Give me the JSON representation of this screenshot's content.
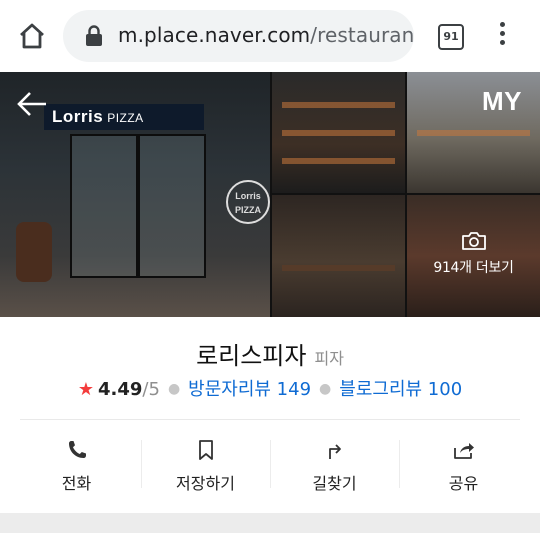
{
  "browser": {
    "url_domain": "m.place.naver.com",
    "url_path": "/restaurant/",
    "tab_count": "91"
  },
  "gallery": {
    "corner_label": "MY",
    "more_photos_label": "914개 더보기",
    "storefront_sign": "Lorris",
    "storefront_sign_sub": "PIZZA",
    "round_logo_line1": "Lorris",
    "round_logo_line2": "PIZZA"
  },
  "place": {
    "name": "로리스피자",
    "category": "피자",
    "rating": "4.49",
    "rating_max": "/5",
    "visitor_reviews": "방문자리뷰 149",
    "blog_reviews": "블로그리뷰 100"
  },
  "actions": [
    {
      "label": "전화",
      "icon": "phone-icon"
    },
    {
      "label": "저장하기",
      "icon": "bookmark-icon"
    },
    {
      "label": "길찾기",
      "icon": "directions-icon"
    },
    {
      "label": "공유",
      "icon": "share-icon"
    }
  ],
  "colors": {
    "link": "#0f6bd3",
    "star": "#f43c3c"
  }
}
